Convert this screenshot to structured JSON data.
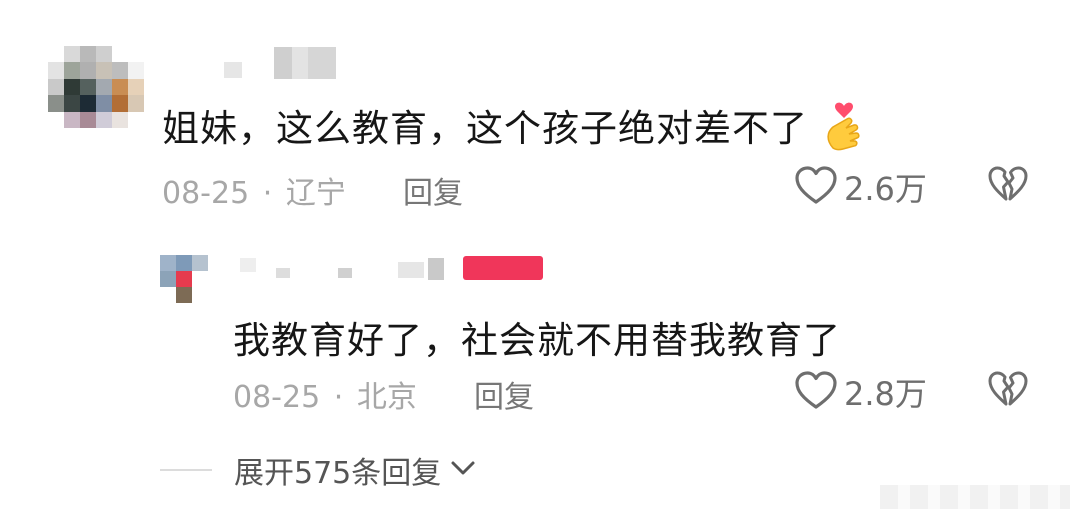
{
  "comments": [
    {
      "text": "姐妹，这么教育，这个孩子绝对差不了",
      "emoji": "finger-heart-emoji",
      "date": "08-25",
      "separator": "·",
      "location": "辽宁",
      "reply_label": "回复",
      "likes": "2.6万"
    }
  ],
  "replies": [
    {
      "text": "我教育好了，社会就不用替我教育了",
      "date": "08-25",
      "separator": "·",
      "location": "北京",
      "reply_label": "回复",
      "likes": "2.8万"
    }
  ],
  "expand_replies": {
    "label": "展开575条回复"
  },
  "icons": {
    "like": "heart-outline-icon",
    "dislike": "broken-heart-icon",
    "expand": "chevron-down-icon"
  },
  "colors": {
    "author_badge": "#f0365a"
  }
}
